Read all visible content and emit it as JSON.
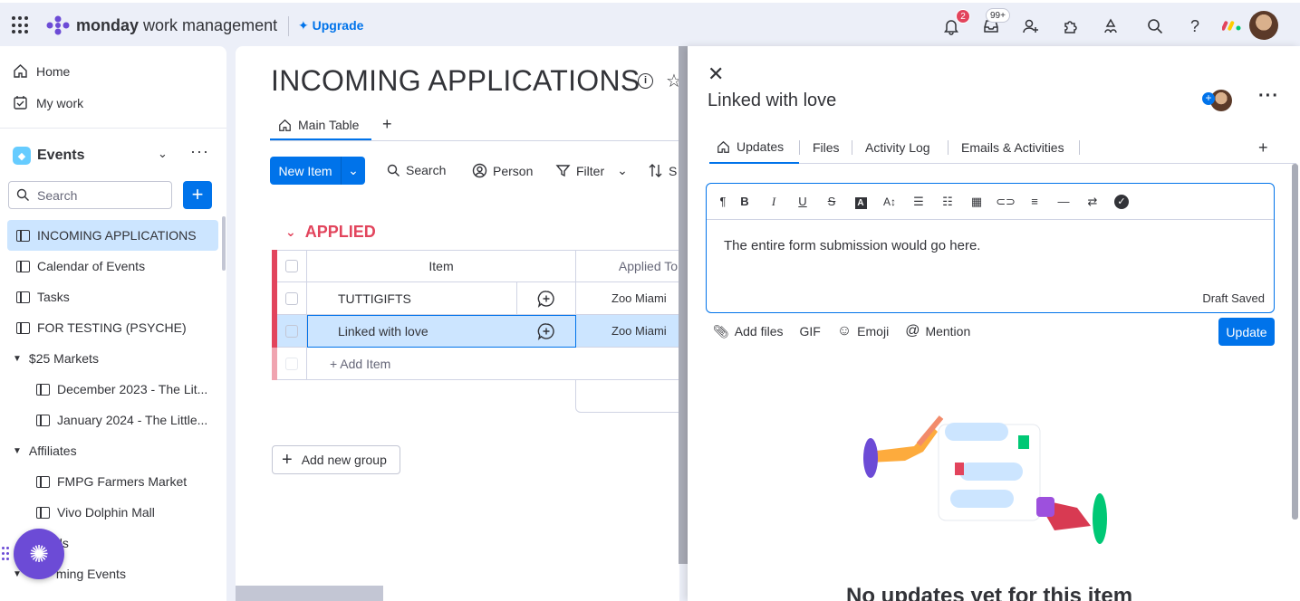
{
  "topbar": {
    "brand_bold": "monday",
    "brand_rest": "work management",
    "upgrade": "Upgrade",
    "notifications_count": "2",
    "inbox_count": "99+"
  },
  "sidebar": {
    "home": "Home",
    "my_work": "My work",
    "workspace": "Events",
    "search_placeholder": "Search",
    "items": [
      {
        "label": "INCOMING APPLICATIONS"
      },
      {
        "label": "Calendar of Events"
      },
      {
        "label": "Tasks"
      },
      {
        "label": "FOR TESTING (PSYCHE)"
      },
      {
        "label": "$25 Markets"
      },
      {
        "label": "December 2023 - The Lit..."
      },
      {
        "label": "January 2024 - The Little..."
      },
      {
        "label": "Affiliates"
      },
      {
        "label": "FMPG Farmers Market"
      },
      {
        "label": "Vivo Dolphin Mall"
      },
      {
        "label": "ols"
      },
      {
        "label": "ming Events"
      }
    ]
  },
  "board": {
    "title": "INCOMING APPLICATIONS",
    "view_tab": "Main Table",
    "new_item": "New Item",
    "search": "Search",
    "person": "Person",
    "filter": "Filter",
    "sort_partial": "S",
    "group": "APPLIED",
    "columns": {
      "item": "Item",
      "applied_to": "Applied To"
    },
    "rows": [
      {
        "name": "TUTTIGIFTS",
        "applied_to": "Zoo Miami"
      },
      {
        "name": "Linked with love",
        "applied_to": "Zoo Miami"
      }
    ],
    "add_item": "+ Add Item",
    "add_group": "Add new group"
  },
  "panel": {
    "title": "Linked with love",
    "tabs": [
      "Updates",
      "Files",
      "Activity Log",
      "Emails & Activities"
    ],
    "editor_text": "The entire form submission would go here.",
    "draft_status": "Draft Saved",
    "actions": {
      "add_files": "Add files",
      "gif": "GIF",
      "emoji": "Emoji",
      "mention": "Mention"
    },
    "update_button": "Update",
    "empty_title": "No updates yet for this item"
  },
  "colors": {
    "accent": "#0073ea",
    "group": "#e2445c",
    "selected_row": "#cce5ff",
    "fab": "#6c4bd6"
  }
}
